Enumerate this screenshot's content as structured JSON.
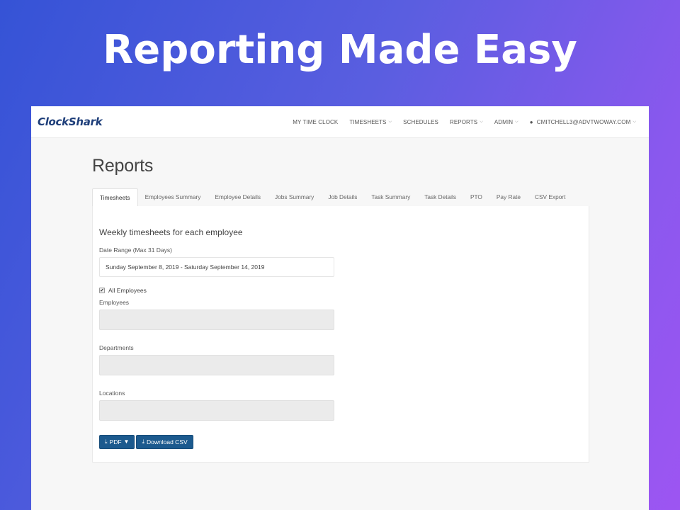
{
  "hero": {
    "title": "Reporting Made Easy"
  },
  "navbar": {
    "logo": "ClockShark",
    "items": [
      {
        "label": "MY TIME CLOCK",
        "dropdown": false
      },
      {
        "label": "TIMESHEETS",
        "dropdown": true
      },
      {
        "label": "SCHEDULES",
        "dropdown": false
      },
      {
        "label": "REPORTS",
        "dropdown": true
      },
      {
        "label": "ADMIN",
        "dropdown": true
      }
    ],
    "user": {
      "label": "CMITCHELL3@ADVTWOWAY.COM",
      "icon": "user-icon"
    }
  },
  "page": {
    "title": "Reports"
  },
  "tabs": [
    {
      "label": "Timesheets",
      "active": true
    },
    {
      "label": "Employees Summary"
    },
    {
      "label": "Employee Details"
    },
    {
      "label": "Jobs Summary"
    },
    {
      "label": "Job Details"
    },
    {
      "label": "Task Summary"
    },
    {
      "label": "Task Details"
    },
    {
      "label": "PTO"
    },
    {
      "label": "Pay Rate"
    },
    {
      "label": "CSV Export"
    }
  ],
  "panel": {
    "heading": "Weekly timesheets for each employee",
    "date_range": {
      "label": "Date Range (Max 31 Days)",
      "value": "Sunday September 8, 2019 - Saturday September 14, 2019"
    },
    "all_employees": {
      "label": "All Employees",
      "checked": true
    },
    "employees": {
      "label": "Employees"
    },
    "departments": {
      "label": "Departments"
    },
    "locations": {
      "label": "Locations"
    },
    "buttons": {
      "pdf": {
        "label": "PDF",
        "icon": "download-icon"
      },
      "csv": {
        "label": "Download CSV",
        "icon": "download-icon"
      }
    }
  },
  "colors": {
    "primary_button": "#1c5a8e",
    "logo": "#1f3f7a",
    "gradient_start": "#3553d6",
    "gradient_end": "#9d55f2"
  }
}
